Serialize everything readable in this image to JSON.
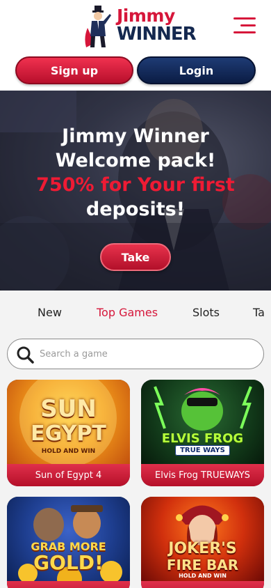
{
  "header": {
    "logo_top": "Jimmy",
    "logo_bottom": "WINNER",
    "menu_icon": "hamburger-menu-icon"
  },
  "auth": {
    "signup_label": "Sign up",
    "login_label": "Login"
  },
  "hero": {
    "line1": "Jimmy Winner",
    "line2": "Welcome pack!",
    "line3": "750% for Your first",
    "line4": "deposits!",
    "cta_label": "Take"
  },
  "tabs": [
    {
      "label": "New"
    },
    {
      "label": "Top Games"
    },
    {
      "label": "Slots"
    },
    {
      "label": "Ta"
    }
  ],
  "search": {
    "placeholder": "Search a game",
    "icon": "search-icon"
  },
  "games": [
    {
      "name": "Sun of Egypt 4",
      "art_line1": "SUN",
      "art_line2": "EGYPT",
      "art_sub": "HOLD AND WIN"
    },
    {
      "name": "Elvis Frog TRUEWAYS",
      "art_line1": "ELVIS FROG",
      "art_line2": "TRUE WAYS",
      "art_sub": ""
    },
    {
      "name": "Grab more Gold!",
      "art_line1": "GRAB MORE",
      "art_line2": "GOLD!",
      "art_sub": ""
    },
    {
      "name": "Joker's Fire Bar Hold",
      "art_line1": "JOKER'S",
      "art_line2": "FIRE BAR",
      "art_sub": "HOLD AND WIN"
    }
  ],
  "colors": {
    "brand_red": "#d6163a",
    "brand_navy": "#14284f"
  }
}
